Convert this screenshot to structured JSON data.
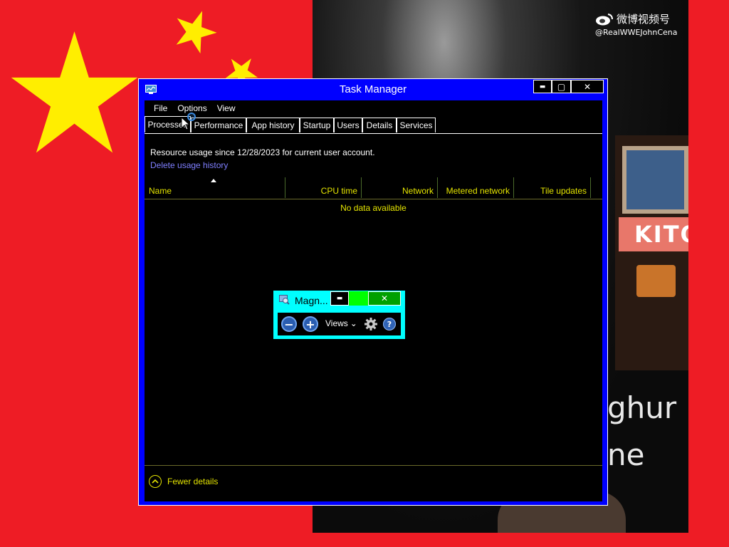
{
  "desktop": {
    "watermark_site": "微博视频号",
    "watermark_handle": "@RealWWEJohnCena",
    "video_sign": "KITO",
    "video_caption_line1": "ghur",
    "video_caption_line2": "ne",
    "flag_colors": {
      "red": "#ee1c25",
      "yellow": "#ffee00"
    }
  },
  "task_manager": {
    "title": "Task Manager",
    "caption_buttons": {
      "minimize": "▬",
      "maximize": "▢",
      "close": "✕"
    },
    "menu": [
      "File",
      "Options",
      "View"
    ],
    "tabs": [
      {
        "label": "Processes",
        "active": true
      },
      {
        "label": "Performance",
        "active": false
      },
      {
        "label": "App history",
        "active": false
      },
      {
        "label": "Startup",
        "active": false
      },
      {
        "label": "Users",
        "active": false
      },
      {
        "label": "Details",
        "active": false
      },
      {
        "label": "Services",
        "active": false
      }
    ],
    "resource_text": "Resource usage since 12/28/2023 for current user account.",
    "delete_link": "Delete usage history",
    "columns": [
      "Name",
      "CPU time",
      "Network",
      "Metered network",
      "Tile updates"
    ],
    "empty_message": "No data available",
    "footer_toggle": "Fewer details",
    "colors": {
      "frame": "#0000ff",
      "body": "#000000",
      "text_highlight": "#e4e400",
      "link": "#7f7fff"
    }
  },
  "magnifier": {
    "title": "Magn...",
    "caption_buttons": {
      "minimize": "▬",
      "close": "✕"
    },
    "zoom_out": "−",
    "zoom_in": "+",
    "views_label": "Views",
    "views_dropdown": "⌄",
    "help": "?",
    "colors": {
      "frame": "#00ffff",
      "maximize_hover": "#00ff00",
      "close": "#00a000"
    }
  }
}
